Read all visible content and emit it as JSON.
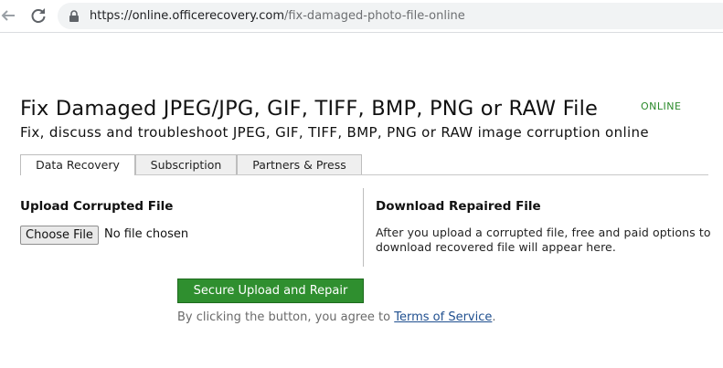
{
  "browser": {
    "url_host": "https://online.officerecovery.com",
    "url_path": "/fix-damaged-photo-file-online"
  },
  "page": {
    "title": "Fix Damaged JPEG/JPG, GIF, TIFF, BMP, PNG or RAW File",
    "badge": "ONLINE",
    "subtitle": "Fix, discuss and troubleshoot JPEG, GIF, TIFF, BMP, PNG or RAW image corruption online"
  },
  "tabs": [
    {
      "label": "Data Recovery",
      "active": true
    },
    {
      "label": "Subscription",
      "active": false
    },
    {
      "label": "Partners & Press",
      "active": false
    }
  ],
  "upload": {
    "heading": "Upload Corrupted File",
    "choose_label": "Choose File",
    "no_file_text": "No file chosen"
  },
  "download": {
    "heading": "Download Repaired File",
    "description": "After you upload a corrupted file, free and paid options to download recovered file will appear here."
  },
  "actions": {
    "repair_label": "Secure Upload and Repair",
    "agree_prefix": "By clicking the button, you agree to ",
    "tos_label": "Terms of Service",
    "agree_suffix": "."
  },
  "colors": {
    "repair_button": "#2f8f2f",
    "badge": "#2b8a2b",
    "link": "#1f4f8f"
  }
}
